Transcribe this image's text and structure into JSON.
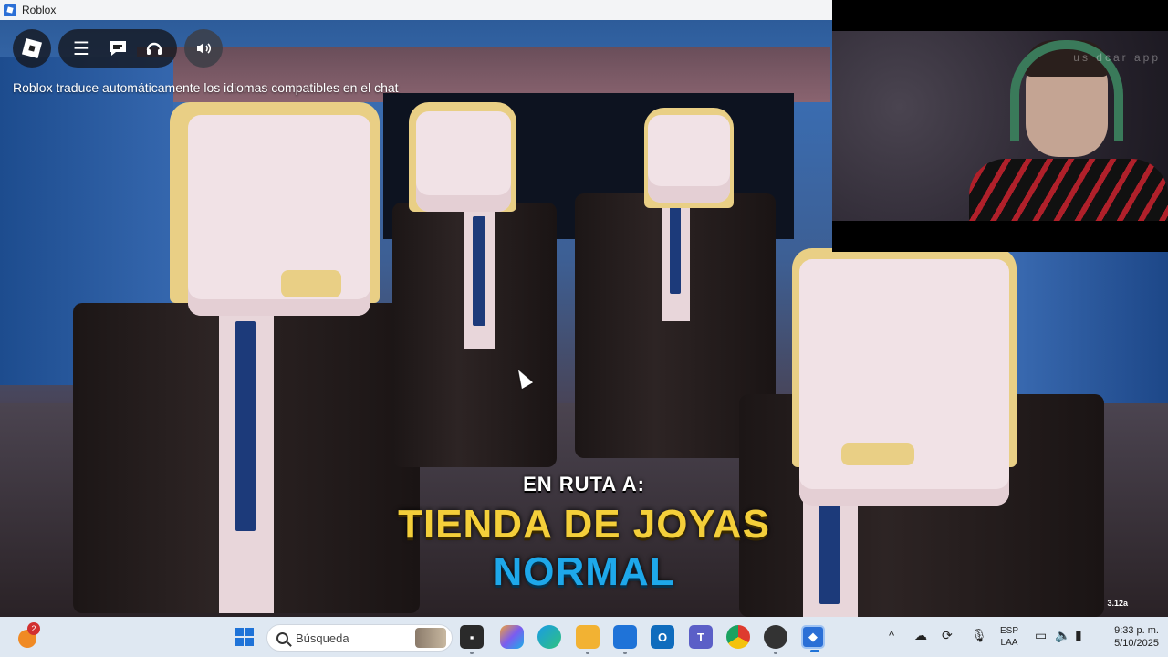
{
  "window": {
    "title": "Roblox"
  },
  "roblox_menu": {
    "icons": [
      "roblox-logo-icon",
      "hamburger-menu-icon",
      "chat-icon",
      "voice-headset-icon",
      "speaker-icon"
    ]
  },
  "chat_notice": "Roblox traduce automáticamente los idiomas compatibles en el chat",
  "route": {
    "label": "EN RUTA A:",
    "destination": "TIENDA DE JOYAS",
    "difficulty": "NORMAL"
  },
  "version": "3.12a",
  "taskbar": {
    "weather_badge": "2",
    "search_placeholder": "Búsqueda",
    "apps": [
      {
        "name": "file-explorer-folder",
        "color": "#f2c14e"
      },
      {
        "name": "copilot",
        "color": "#7b5cf0"
      },
      {
        "name": "edge",
        "color": "#1a9be6"
      },
      {
        "name": "file-explorer",
        "color": "#f2b233"
      },
      {
        "name": "microsoft-store",
        "color": "#1f73d8"
      },
      {
        "name": "outlook",
        "color": "#0f6cbd"
      },
      {
        "name": "teams",
        "color": "#5b5fc7"
      },
      {
        "name": "chrome",
        "color": "#de3b2f"
      },
      {
        "name": "recorder",
        "color": "#333333"
      },
      {
        "name": "roblox",
        "color": "#2b6fd6"
      }
    ],
    "language": {
      "code": "ESP",
      "layout": "LAA"
    },
    "clock": {
      "time": "9:33 p. m.",
      "date": "5/10/2025"
    }
  },
  "webcam": {
    "watermark": "us   dcar app"
  }
}
